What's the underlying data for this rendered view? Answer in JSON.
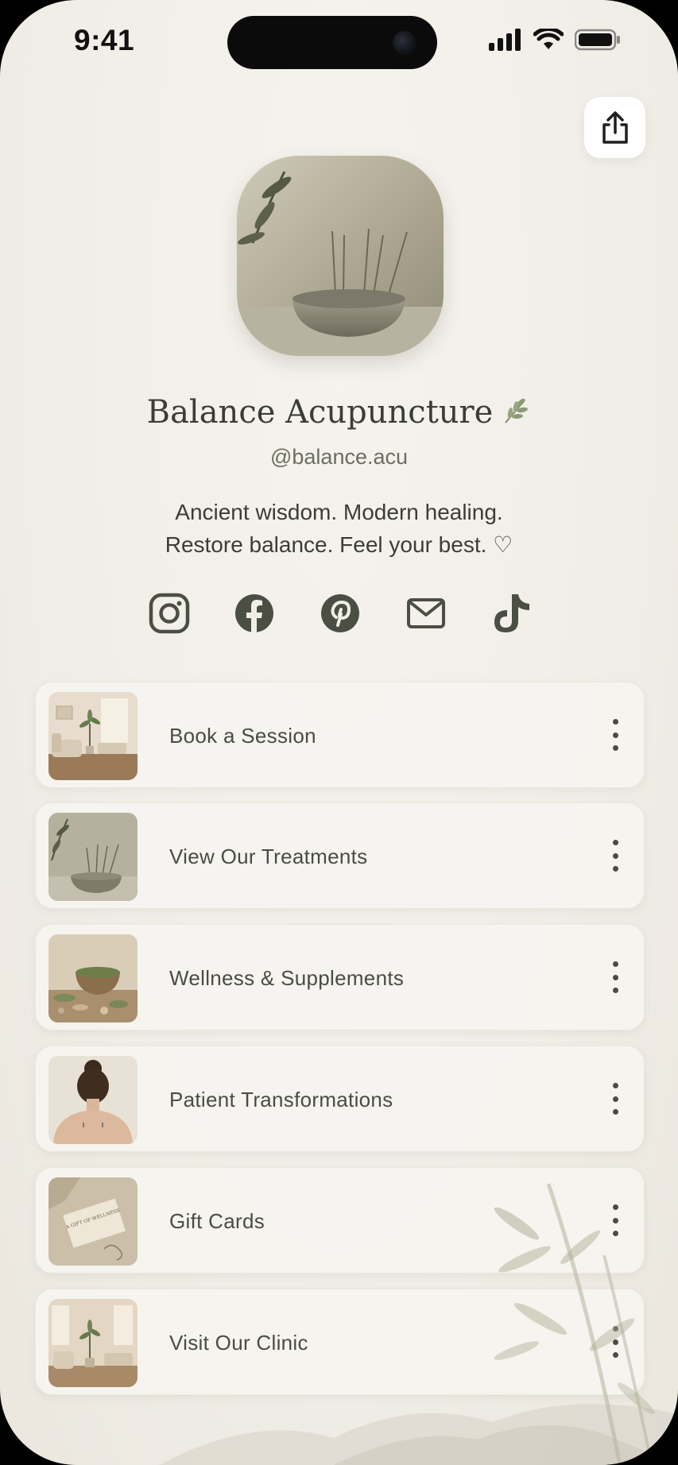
{
  "status_bar": {
    "time": "9:41"
  },
  "share": {
    "icon": "share-icon"
  },
  "profile": {
    "name": "Balance Acupuncture",
    "handle": "@balance.acu",
    "bio_line1": "Ancient wisdom. Modern healing.",
    "bio_line2": "Restore balance. Feel your best. ♡"
  },
  "socials": [
    {
      "icon": "instagram-icon"
    },
    {
      "icon": "facebook-icon"
    },
    {
      "icon": "pinterest-icon"
    },
    {
      "icon": "mail-icon"
    },
    {
      "icon": "tiktok-icon"
    }
  ],
  "links": [
    {
      "label": "Book a Session",
      "thumb": "room-interior"
    },
    {
      "label": "View Our Treatments",
      "thumb": "needle-bowl"
    },
    {
      "label": "Wellness & Supplements",
      "thumb": "herb-bowl"
    },
    {
      "label": "Patient Transformations",
      "thumb": "patient-back"
    },
    {
      "label": "Gift Cards",
      "thumb": "gift-card"
    },
    {
      "label": "Visit Our Clinic",
      "thumb": "clinic-room"
    }
  ],
  "gift_card_text": "A GIFT OF WELLNESS",
  "colors": {
    "text": "#3a3d33",
    "muted": "#6b6f60",
    "background": "#f2efe9",
    "card": "#f6f4f0"
  }
}
